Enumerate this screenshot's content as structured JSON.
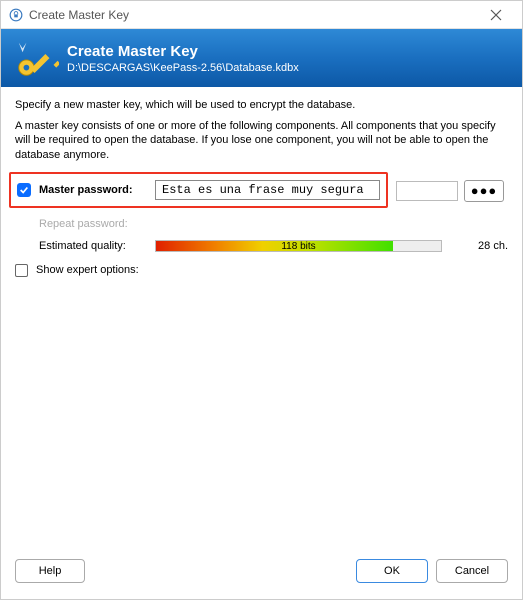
{
  "window": {
    "title": "Create Master Key"
  },
  "banner": {
    "title": "Create Master Key",
    "subtitle": "D:\\DESCARGAS\\KeePass-2.56\\Database.kdbx"
  },
  "intro": "Specify a new master key, which will be used to encrypt the database.",
  "description": "A master key consists of one or more of the following components. All components that you specify will be required to open the database. If you lose one component, you will not be able to open the database anymore.",
  "master": {
    "checkbox_checked": true,
    "label": "Master password:",
    "value": "Esta es una frase muy segura"
  },
  "repeat": {
    "label": "Repeat password:"
  },
  "quality": {
    "label": "Estimated quality:",
    "bits_text": "118 bits",
    "char_count": "28 ch."
  },
  "expert": {
    "label": "Show expert options:"
  },
  "buttons": {
    "help": "Help",
    "ok": "OK",
    "cancel": "Cancel",
    "reveal": "●●●"
  }
}
